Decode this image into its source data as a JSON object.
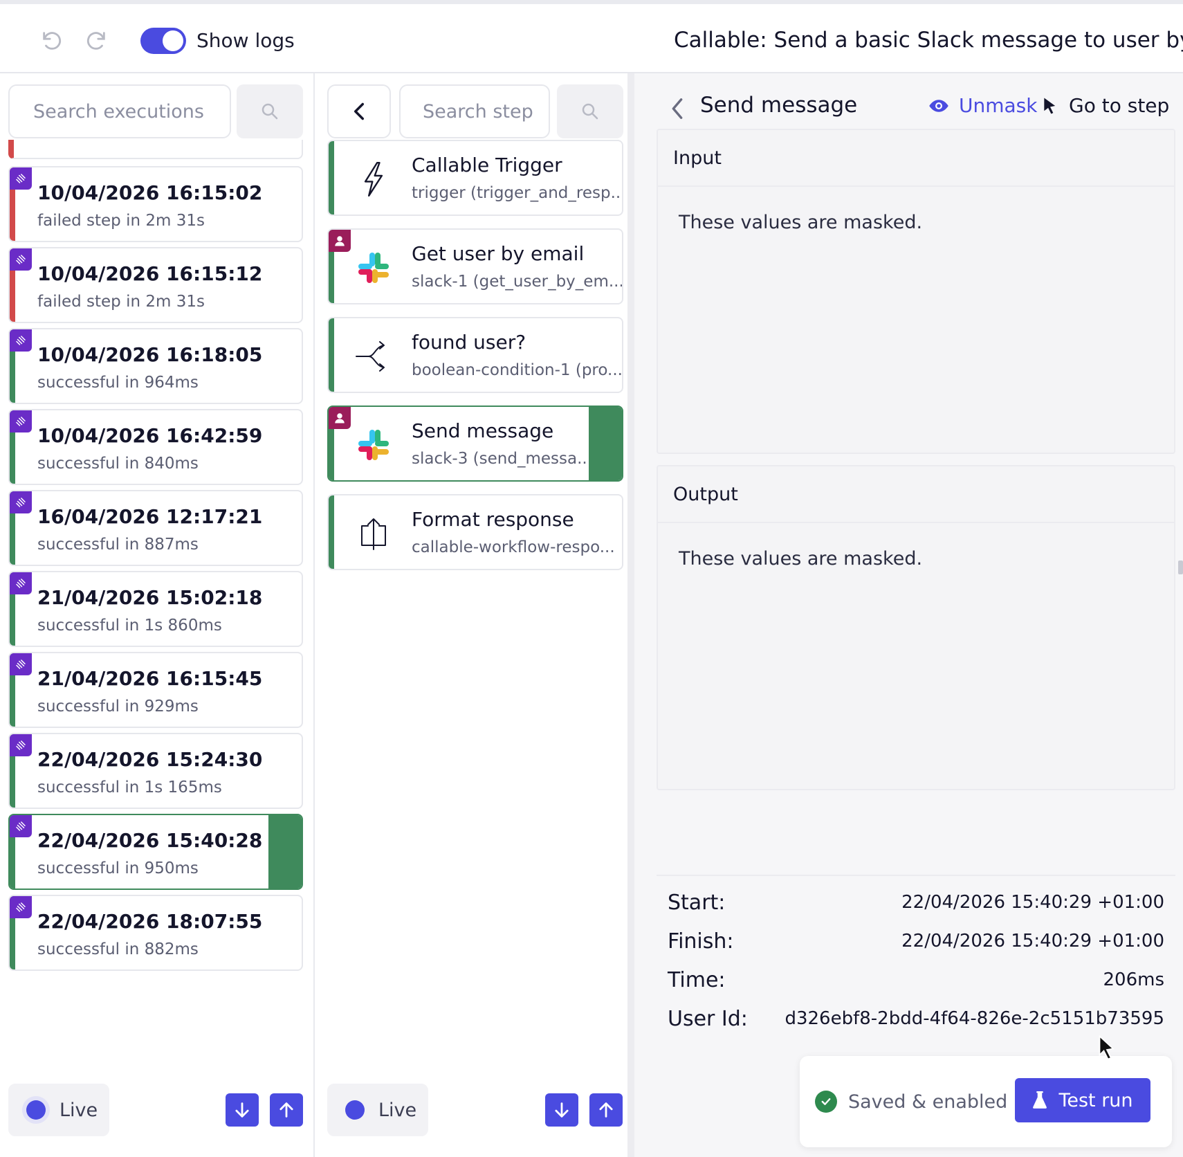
{
  "header": {
    "show_logs_label": "Show logs",
    "show_logs_on": true,
    "workflow_title": "Callable: Send a basic Slack message to user by em"
  },
  "executions": {
    "search_placeholder": "Search executions",
    "items": [
      {
        "date": "10/04/2026 16:15:02",
        "status": "failed step in 2m 31s",
        "state": "failed"
      },
      {
        "date": "10/04/2026 16:15:12",
        "status": "failed step in 2m 31s",
        "state": "failed"
      },
      {
        "date": "10/04/2026 16:18:05",
        "status": "successful in 964ms",
        "state": "success"
      },
      {
        "date": "10/04/2026 16:42:59",
        "status": "successful in 840ms",
        "state": "success"
      },
      {
        "date": "16/04/2026 12:17:21",
        "status": "successful in 887ms",
        "state": "success"
      },
      {
        "date": "21/04/2026 15:02:18",
        "status": "successful in 1s 860ms",
        "state": "success"
      },
      {
        "date": "21/04/2026 16:15:45",
        "status": "successful in 929ms",
        "state": "success"
      },
      {
        "date": "22/04/2026 15:24:30",
        "status": "successful in 1s 165ms",
        "state": "success"
      },
      {
        "date": "22/04/2026 15:40:28",
        "status": "successful in 950ms",
        "state": "success",
        "selected": true
      },
      {
        "date": "22/04/2026 18:07:55",
        "status": "successful in 882ms",
        "state": "success"
      }
    ],
    "live_label": "Live"
  },
  "steps": {
    "search_placeholder": "Search step",
    "items": [
      {
        "name": "Callable Trigger",
        "sub": "trigger (trigger_and_resp...",
        "icon": "lightning-icon"
      },
      {
        "name": "Get user by email",
        "sub": "slack-1 (get_user_by_em...",
        "icon": "slack-icon",
        "user_tag": true
      },
      {
        "name": "found user?",
        "sub": "boolean-condition-1 (pro...",
        "icon": "branch-icon"
      },
      {
        "name": "Send message",
        "sub": "slack-3 (send_messa...",
        "icon": "slack-icon",
        "user_tag": true,
        "selected": true
      },
      {
        "name": "Format response",
        "sub": "callable-workflow-respo...",
        "icon": "upload-box-icon"
      }
    ],
    "live_label": "Live"
  },
  "detail": {
    "title": "Send message",
    "unmask_label": "Unmask",
    "goto_label": "Go to step",
    "input_label": "Input",
    "input_text": "These values are masked.",
    "output_label": "Output",
    "output_text": "These values are masked.",
    "meta": {
      "start_label": "Start:",
      "start_value": "22/04/2026 15:40:29 +01:00",
      "finish_label": "Finish:",
      "finish_value": "22/04/2026 15:40:29 +01:00",
      "time_label": "Time:",
      "time_value": "206ms",
      "userid_label": "User Id:",
      "userid_value": "d326ebf8-2bdd-4f64-826e-2c5151b73595"
    }
  },
  "footer": {
    "saved_label": "Saved & enabled",
    "test_run_label": "Test run"
  },
  "colors": {
    "accent": "#4a4be0",
    "success": "#3f8a5c",
    "failed": "#d24a4a",
    "tag_purple": "#6a2cc7",
    "user_tag": "#9a1d5a"
  }
}
